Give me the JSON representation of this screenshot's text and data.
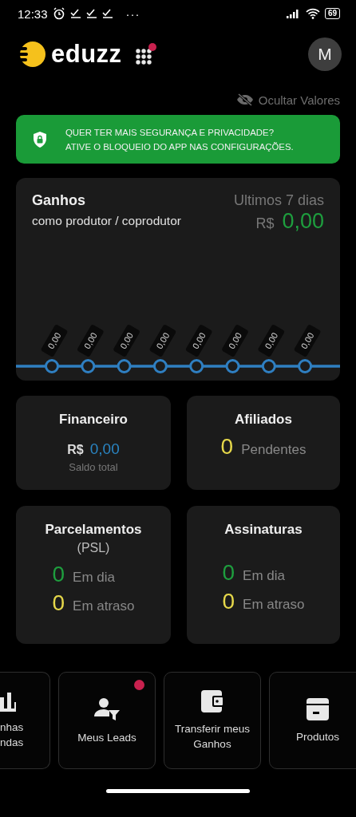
{
  "status_bar": {
    "time": "12:33",
    "more": "···",
    "battery": "69"
  },
  "header": {
    "logo": "eduzz",
    "apps_badge": true,
    "avatar": "M"
  },
  "hide_values": {
    "label": "Ocultar Valores"
  },
  "security_banner": {
    "lines": [
      "QUER TER MAIS SEGURANÇA E PRIVACIDADE?",
      "ATIVE O BLOQUEIO DO APP NAS CONFIGURAÇÕES."
    ]
  },
  "earnings": {
    "title": "Ganhos",
    "subtitle": "como produtor / coprodutor",
    "period": "Ultimos 7 dias",
    "currency": "R$",
    "amount": "0,00",
    "point_labels": [
      "0,00",
      "0,00",
      "0,00",
      "0,00",
      "0,00",
      "0,00",
      "0,00",
      "0,00"
    ]
  },
  "cards": [
    {
      "kind": "balance",
      "title": "Financeiro",
      "currency": "R$",
      "amount": "0,00",
      "caption": "Saldo total"
    },
    {
      "kind": "counts",
      "title": "Afiliados",
      "rows": [
        {
          "count": "0",
          "label": "Pendentes",
          "color": "#e6d84a"
        }
      ]
    },
    {
      "kind": "counts",
      "title": "Parcelamentos",
      "subtitle": "(PSL)",
      "rows": [
        {
          "count": "0",
          "label": "Em dia",
          "color": "#1e9e3e"
        },
        {
          "count": "0",
          "label": "Em atraso",
          "color": "#e6d84a"
        }
      ]
    },
    {
      "kind": "counts",
      "title": "Assinaturas",
      "rows": [
        {
          "count": "0",
          "label": "Em dia",
          "color": "#1e9e3e"
        },
        {
          "count": "0",
          "label": "Em atraso",
          "color": "#e6d84a"
        }
      ]
    }
  ],
  "shortcuts": [
    {
      "label": "nhas\nndas",
      "badge": false,
      "partial": true
    },
    {
      "label": "Meus Leads",
      "badge": true,
      "partial": false
    },
    {
      "label": "Transferir meus Ganhos",
      "badge": false,
      "partial": false
    },
    {
      "label": "Produtos",
      "badge": false,
      "partial": false
    }
  ]
}
